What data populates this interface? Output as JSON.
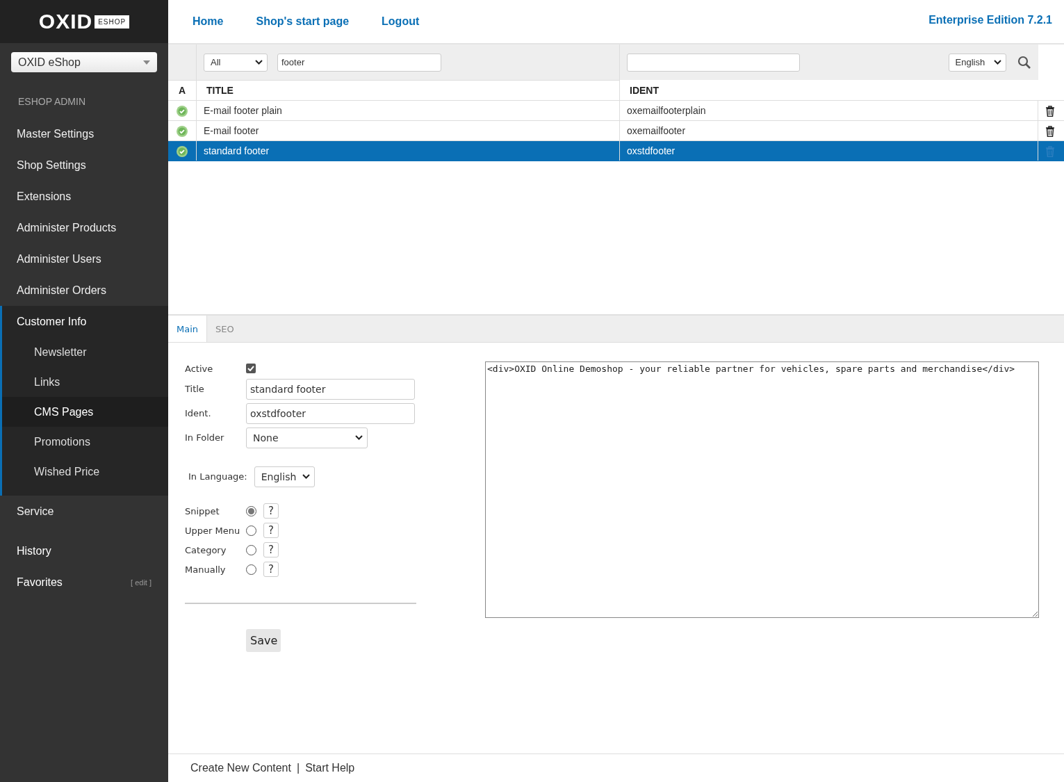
{
  "logo": {
    "wordmark": "OXID",
    "badge": "ESHOP"
  },
  "shop_select": {
    "value": "OXID eShop"
  },
  "sidebar": {
    "heading": "ESHOP ADMIN",
    "items": [
      {
        "label": "Master Settings",
        "expanded": false
      },
      {
        "label": "Shop Settings",
        "expanded": false
      },
      {
        "label": "Extensions",
        "expanded": false
      },
      {
        "label": "Administer Products",
        "expanded": false
      },
      {
        "label": "Administer Users",
        "expanded": false
      },
      {
        "label": "Administer Orders",
        "expanded": false
      },
      {
        "label": "Customer Info",
        "expanded": true,
        "children": [
          {
            "label": "Newsletter",
            "selected": false
          },
          {
            "label": "Links",
            "selected": false
          },
          {
            "label": "CMS Pages",
            "selected": true
          },
          {
            "label": "Promotions",
            "selected": false
          },
          {
            "label": "Wished Price",
            "selected": false
          }
        ]
      },
      {
        "label": "Service",
        "expanded": false
      }
    ],
    "history": "History",
    "favorites": {
      "label": "Favorites",
      "edit": "[ edit ]"
    }
  },
  "top_nav": {
    "links": [
      "Home",
      "Shop's start page",
      "Logout"
    ],
    "edition": "Enterprise Edition 7.2.1"
  },
  "filters": {
    "type_select": "All",
    "title_filter": "footer",
    "language_select": "English"
  },
  "table": {
    "columns": [
      "A",
      "TITLE",
      "IDENT"
    ],
    "rows": [
      {
        "active": true,
        "title": "E-mail footer plain",
        "ident": "oxemailfooterplain",
        "selected": false
      },
      {
        "active": true,
        "title": "E-mail footer",
        "ident": "oxemailfooter",
        "selected": false
      },
      {
        "active": true,
        "title": "standard footer",
        "ident": "oxstdfooter",
        "selected": true
      }
    ]
  },
  "tabs": [
    {
      "label": "Main",
      "selected": true
    },
    {
      "label": "SEO",
      "selected": false
    }
  ],
  "form": {
    "active": {
      "label": "Active",
      "checked": true
    },
    "title": {
      "label": "Title",
      "value": "standard footer"
    },
    "ident": {
      "label": "Ident.",
      "value": "oxstdfooter"
    },
    "folder": {
      "label": "In Folder",
      "value": "None"
    },
    "language": {
      "label": "In Language:",
      "value": "English"
    },
    "placements": [
      {
        "label": "Snippet",
        "selected": true,
        "help": "?"
      },
      {
        "label": "Upper Menu",
        "selected": false,
        "help": "?"
      },
      {
        "label": "Category",
        "selected": false,
        "help": "?"
      },
      {
        "label": "Manually",
        "selected": false,
        "help": "?"
      }
    ],
    "save": "Save",
    "content": "<div>OXID Online Demoshop - your reliable partner for vehicles, spare parts and merchandise</div>"
  },
  "footer": {
    "links": [
      "Create New Content",
      "Start Help"
    ],
    "separator": "|"
  }
}
